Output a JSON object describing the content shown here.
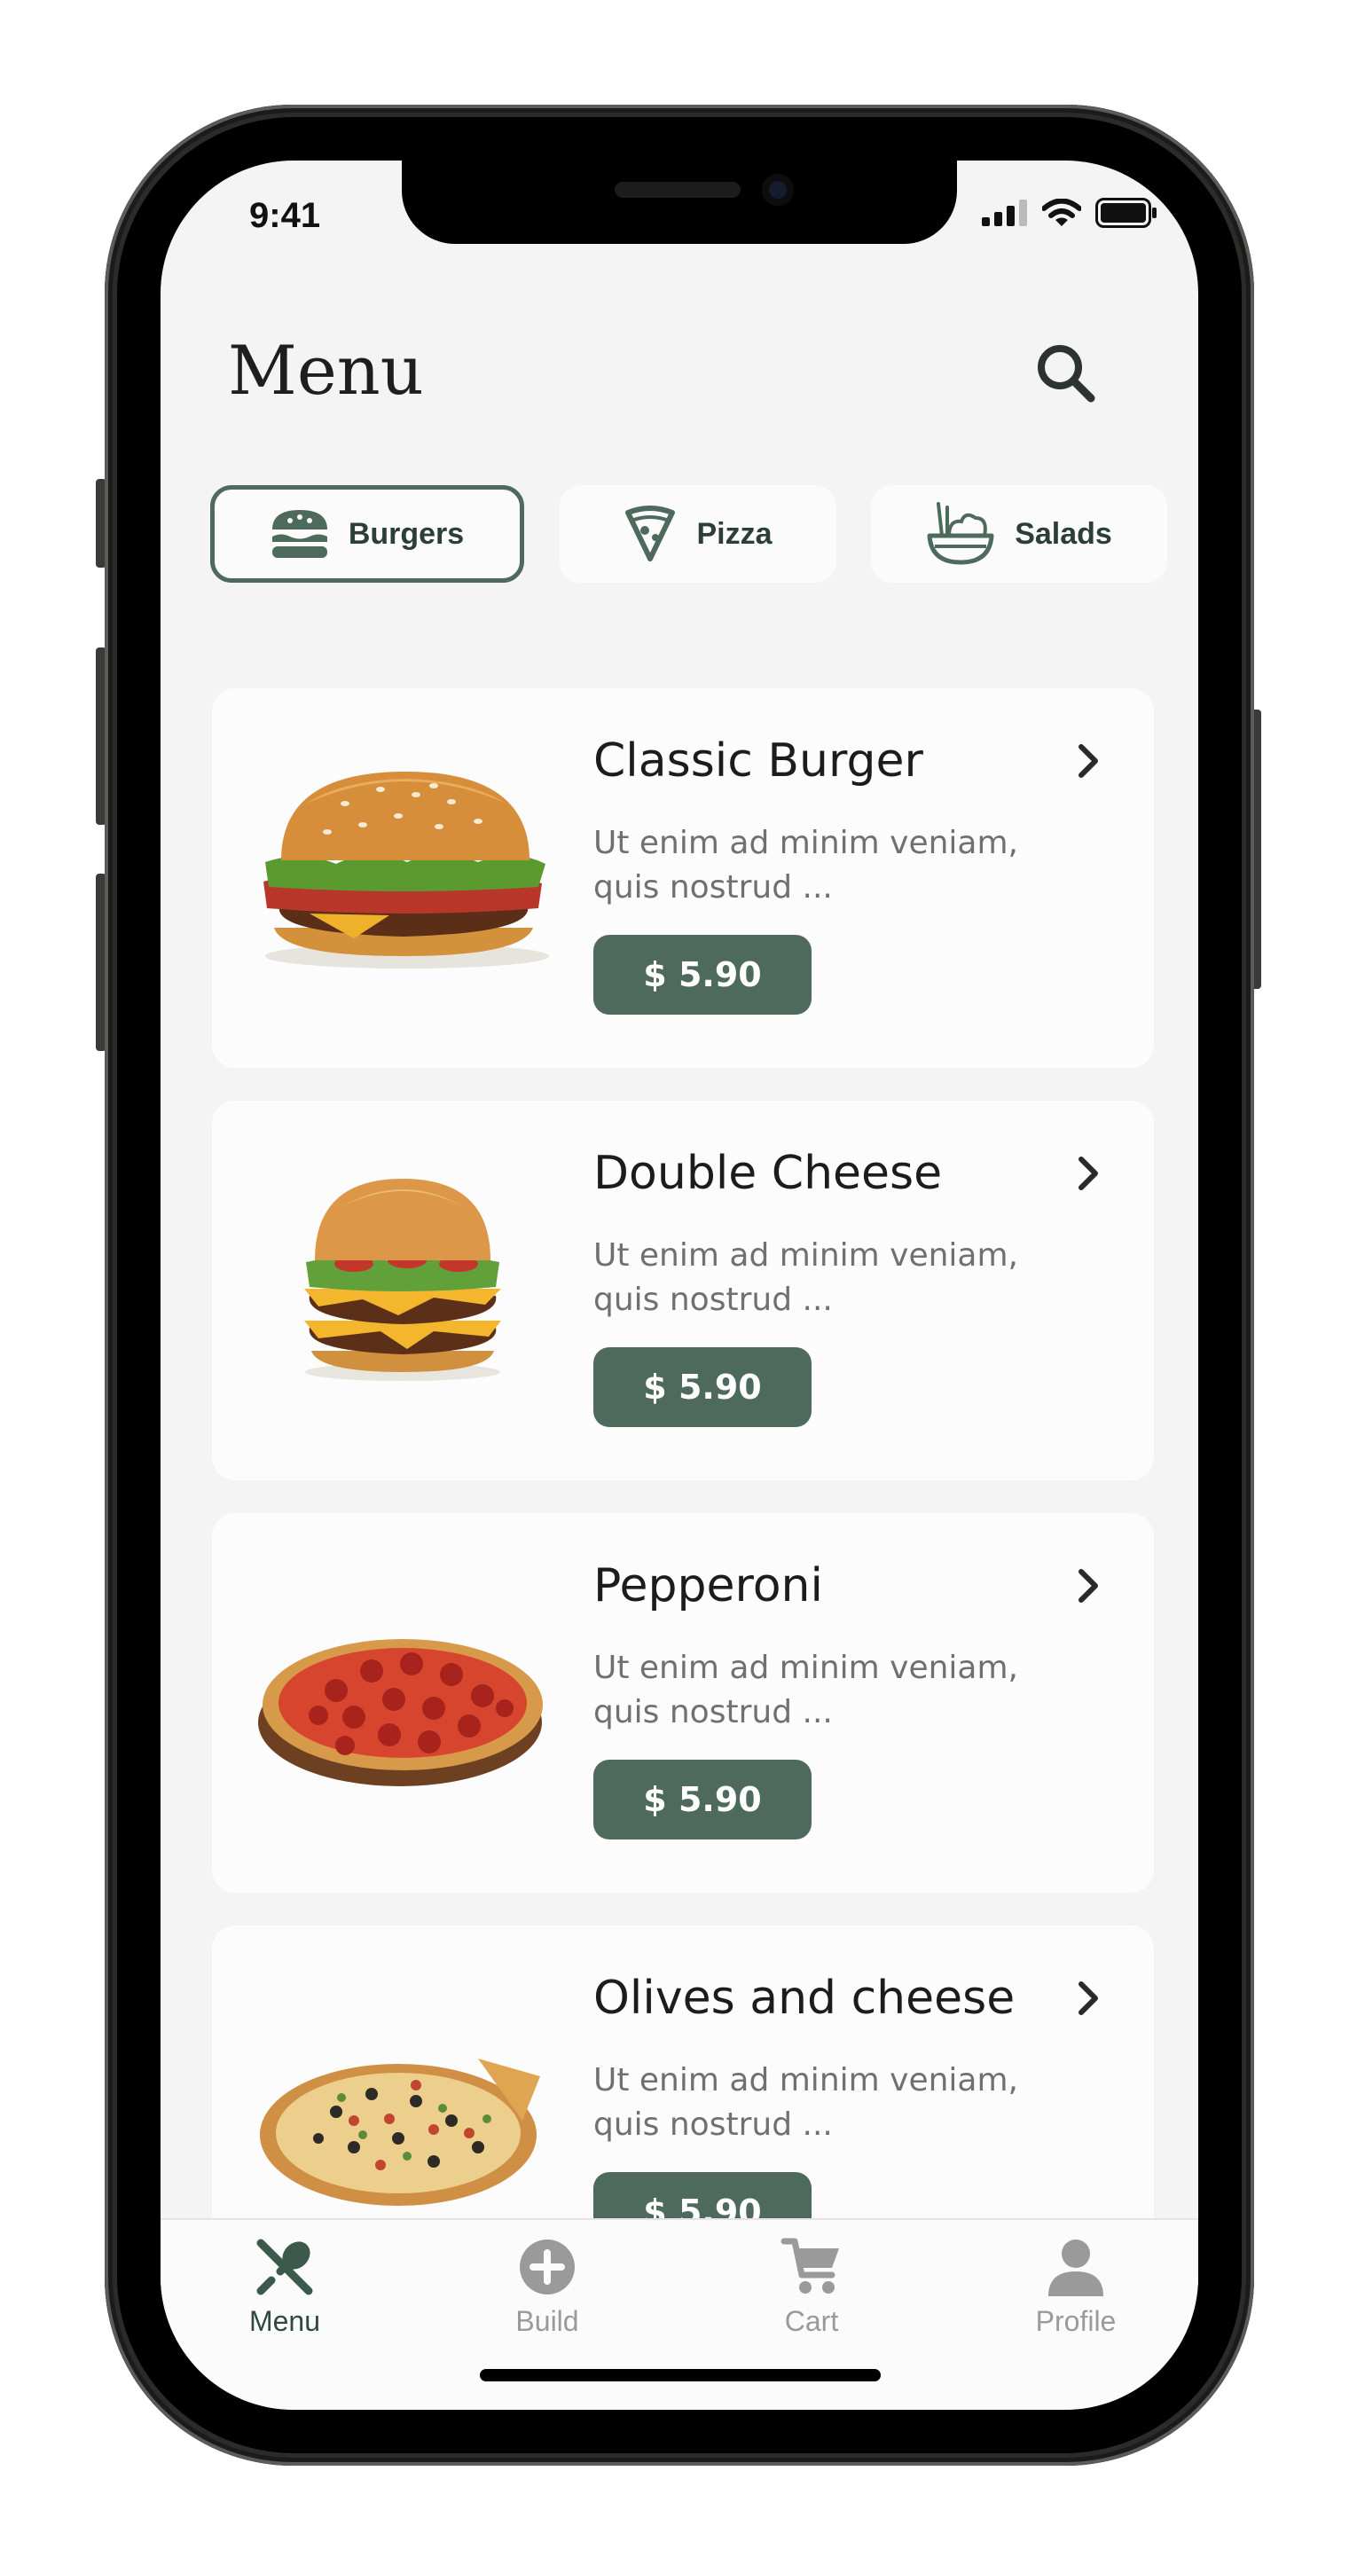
{
  "status_bar": {
    "time": "9:41"
  },
  "header": {
    "title": "Menu",
    "search_icon": "search-icon"
  },
  "categories": [
    {
      "label": "Burgers",
      "icon": "burger-icon",
      "selected": true
    },
    {
      "label": "Pizza",
      "icon": "pizza-slice-icon",
      "selected": false
    },
    {
      "label": "Salads",
      "icon": "salad-bowl-icon",
      "selected": false
    }
  ],
  "products": [
    {
      "name": "Classic Burger",
      "description": "Ut enim ad minim veniam, quis nostrud ...",
      "price": "$ 5.90",
      "image": "classic-burger-photo"
    },
    {
      "name": "Double Cheese",
      "description": "Ut enim ad minim veniam, quis nostrud ...",
      "price": "$ 5.90",
      "image": "double-cheeseburger-photo"
    },
    {
      "name": "Pepperoni",
      "description": "Ut enim ad minim veniam, quis nostrud ...",
      "price": "$ 5.90",
      "image": "pepperoni-pizza-photo"
    },
    {
      "name": "Olives and cheese",
      "description": "Ut enim ad minim veniam, quis nostrud ...",
      "price": "$ 5.90",
      "image": "olives-cheese-pizza-photo"
    }
  ],
  "tabbar": {
    "items": [
      {
        "label": "Menu",
        "icon": "fork-spoon-icon",
        "active": true
      },
      {
        "label": "Build",
        "icon": "plus-circle-icon",
        "active": false
      },
      {
        "label": "Cart",
        "icon": "cart-icon",
        "active": false
      },
      {
        "label": "Profile",
        "icon": "person-icon",
        "active": false
      }
    ]
  },
  "colors": {
    "accent": "#4d6a5c",
    "accent_dark": "#2f4a3e",
    "background": "#f4f4f4",
    "card": "#fcfcfc",
    "muted_text": "#707070",
    "inactive_tab": "#9a9a9a"
  }
}
